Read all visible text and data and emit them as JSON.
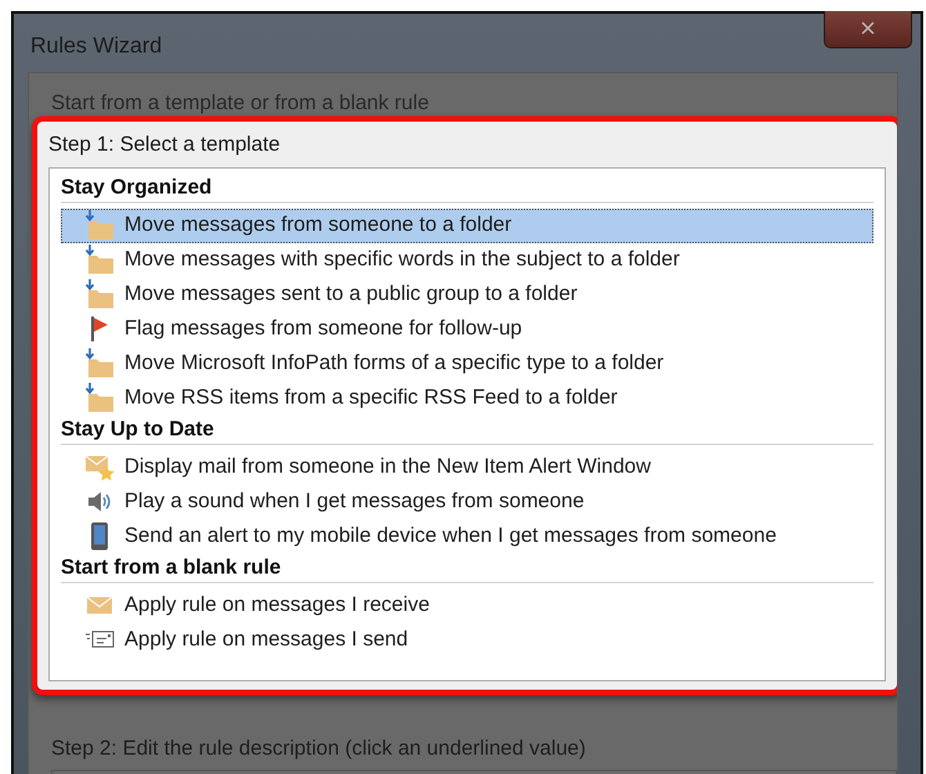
{
  "window": {
    "title": "Rules Wizard",
    "close": "×"
  },
  "intro": "Start from a template or from a blank rule",
  "step1": {
    "label": "Step 1: Select a template",
    "groups": [
      {
        "heading": "Stay Organized",
        "items": [
          {
            "text": "Move messages from someone to a folder",
            "kind": "folder",
            "selected": true
          },
          {
            "text": "Move messages with specific words in the subject to a folder",
            "kind": "folder",
            "selected": false
          },
          {
            "text": "Move messages sent to a public group to a folder",
            "kind": "folder",
            "selected": false
          },
          {
            "text": "Flag messages from someone for follow-up",
            "kind": "flag",
            "selected": false
          },
          {
            "text": "Move Microsoft InfoPath forms of a specific type to a folder",
            "kind": "folder",
            "selected": false
          },
          {
            "text": "Move RSS items from a specific RSS Feed to a folder",
            "kind": "folder",
            "selected": false
          }
        ]
      },
      {
        "heading": "Stay Up to Date",
        "items": [
          {
            "text": "Display mail from someone in the New Item Alert Window",
            "kind": "alert",
            "selected": false
          },
          {
            "text": "Play a sound when I get messages from someone",
            "kind": "sound",
            "selected": false
          },
          {
            "text": "Send an alert to my mobile device when I get messages from someone",
            "kind": "mobile",
            "selected": false
          }
        ]
      },
      {
        "heading": "Start from a blank rule",
        "items": [
          {
            "text": "Apply rule on messages I receive",
            "kind": "receive",
            "selected": false
          },
          {
            "text": "Apply rule on messages I send",
            "kind": "send",
            "selected": false
          }
        ]
      }
    ]
  },
  "step2": {
    "label": "Step 2: Edit the rule description (click an underlined value)"
  }
}
